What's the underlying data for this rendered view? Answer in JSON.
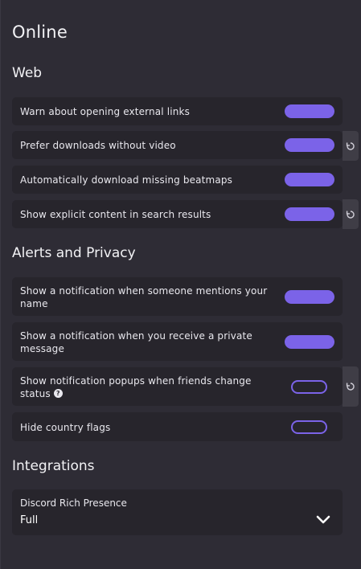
{
  "page": {
    "title": "Online"
  },
  "sections": {
    "web": {
      "title": "Web",
      "items": [
        {
          "label": "Warn about opening external links",
          "enabled": true
        },
        {
          "label": "Prefer downloads without video",
          "enabled": true,
          "has_revert": true
        },
        {
          "label": "Automatically download missing beatmaps",
          "enabled": true
        },
        {
          "label": "Show explicit content in search results",
          "enabled": true,
          "has_revert": true
        }
      ]
    },
    "alerts": {
      "title": "Alerts and Privacy",
      "items": [
        {
          "label": "Show a notification when someone mentions your name",
          "enabled": true
        },
        {
          "label": "Show a notification when you receive a private message",
          "enabled": true
        },
        {
          "label": "Show notification popups when friends change status",
          "enabled": false,
          "has_revert": true,
          "has_help": true
        },
        {
          "label": "Hide country flags",
          "enabled": false
        }
      ]
    },
    "integrations": {
      "title": "Integrations",
      "discord": {
        "label": "Discord Rich Presence",
        "value": "Full"
      }
    }
  },
  "icons": {
    "revert": "revert-icon",
    "help": "help-icon",
    "chevron": "chevron-down-icon"
  },
  "colors": {
    "accent": "#7b63e8",
    "background": "#2e2c35",
    "row_background": "#27252c"
  }
}
